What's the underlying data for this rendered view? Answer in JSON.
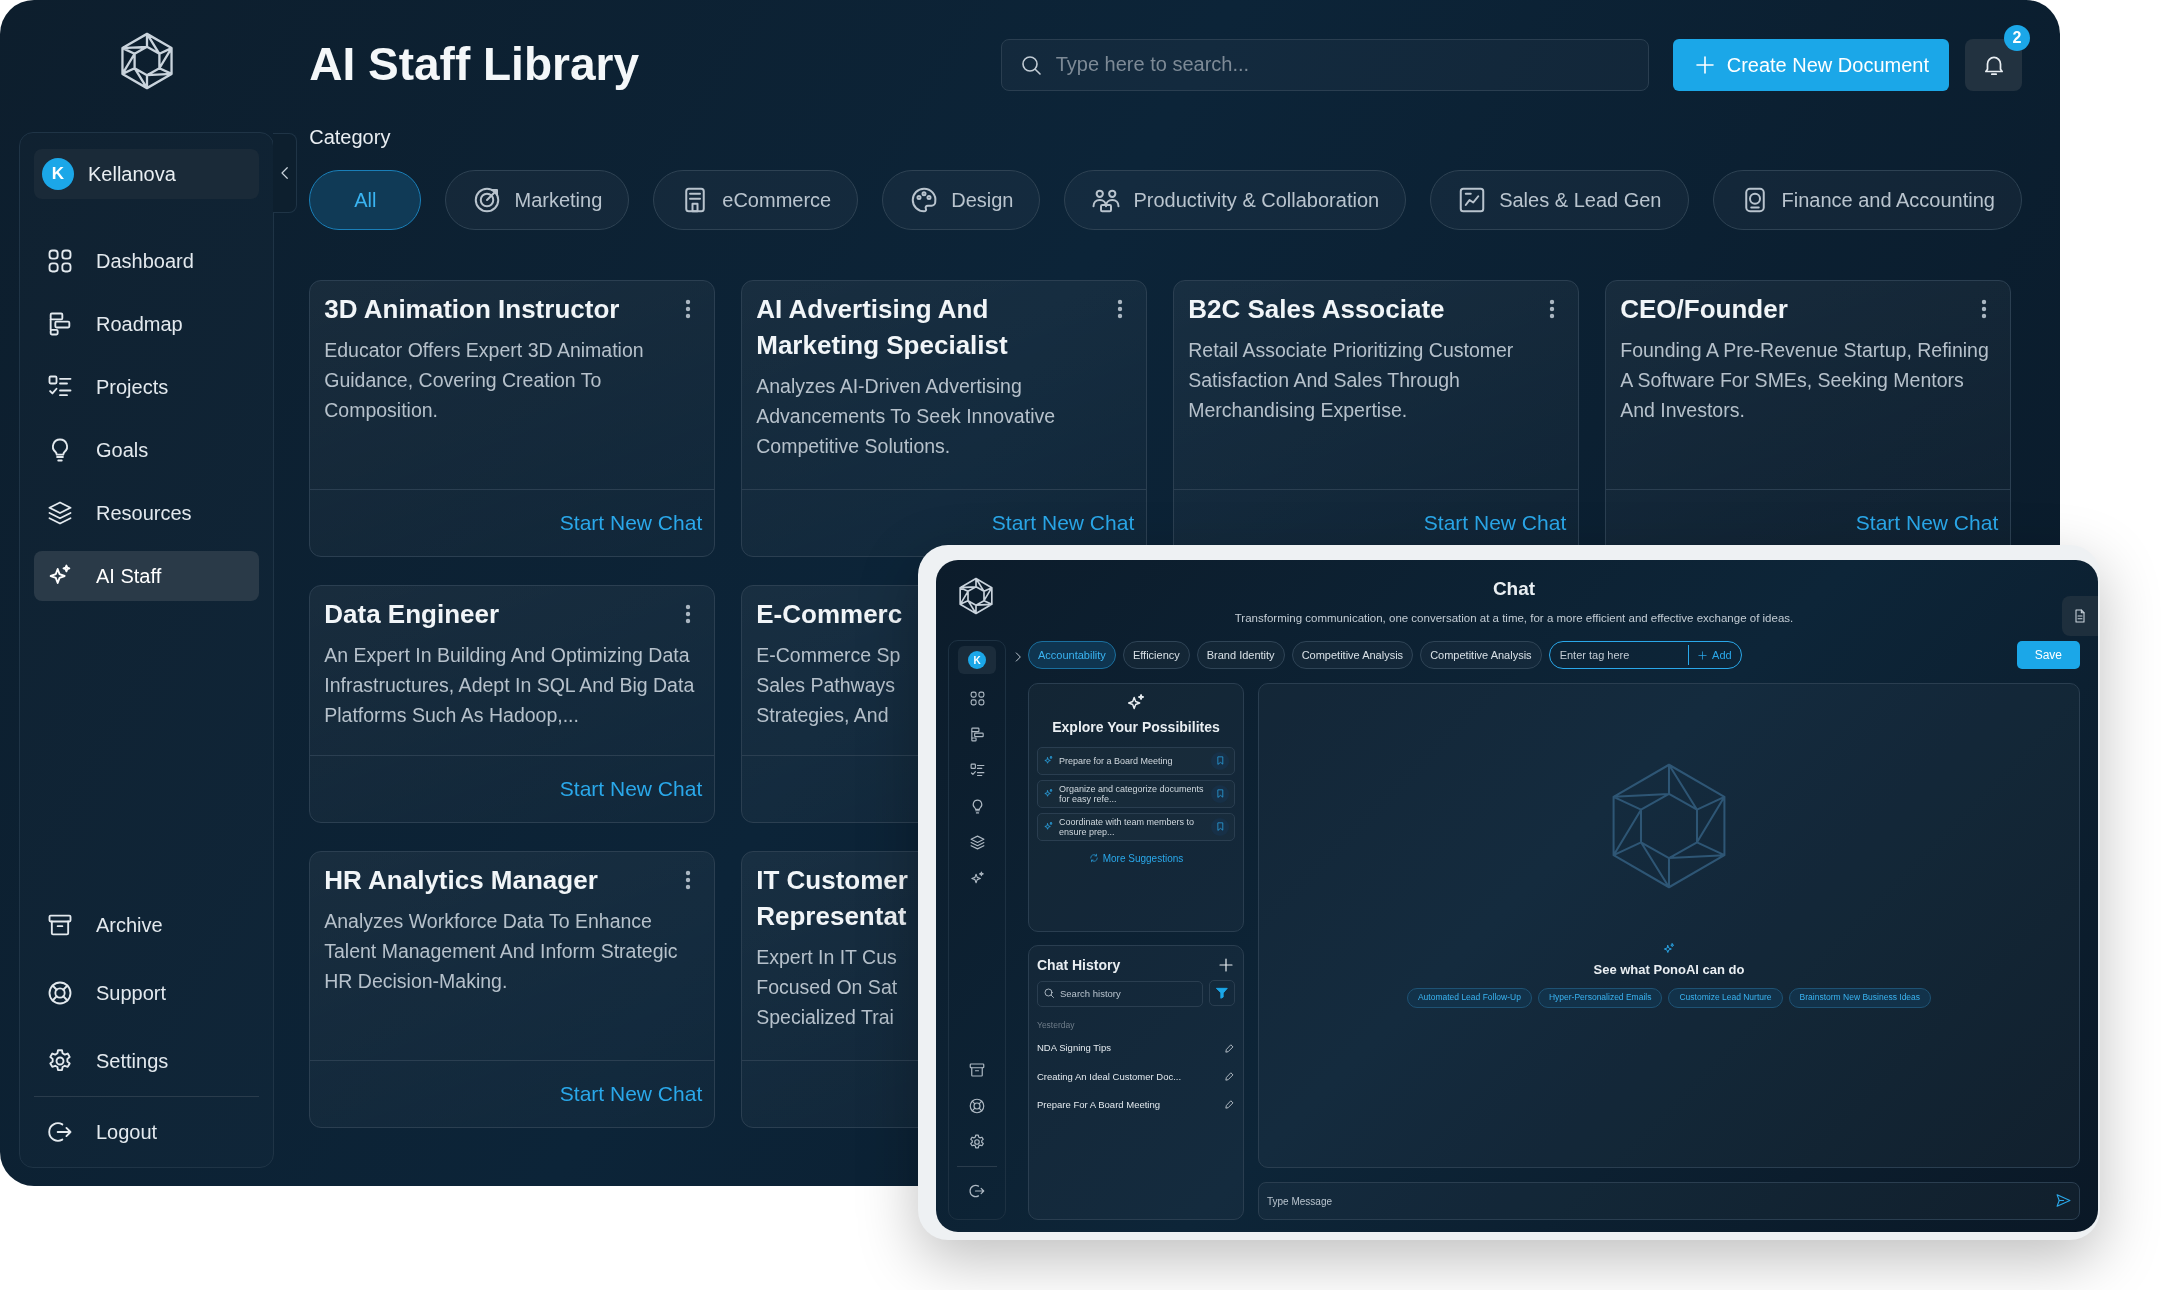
{
  "app": {
    "title": "AI Staff Library"
  },
  "search": {
    "placeholder": "Type here to search..."
  },
  "create_button": "Create New Document",
  "notifications": {
    "count": "2"
  },
  "sidebar": {
    "user": {
      "initial": "K",
      "name": "Kellanova"
    },
    "items": [
      {
        "label": "Dashboard",
        "selected": false
      },
      {
        "label": "Roadmap",
        "selected": false
      },
      {
        "label": "Projects",
        "selected": false
      },
      {
        "label": "Goals",
        "selected": false
      },
      {
        "label": "Resources",
        "selected": false
      },
      {
        "label": "AI Staff",
        "selected": true
      }
    ],
    "bottom_items": [
      "Archive",
      "Support",
      "Settings"
    ],
    "logout": "Logout"
  },
  "category": {
    "label": "Category",
    "chips": [
      {
        "label": "All",
        "selected": true
      },
      {
        "label": "Marketing",
        "selected": false
      },
      {
        "label": "eCommerce",
        "selected": false
      },
      {
        "label": "Design",
        "selected": false
      },
      {
        "label": "Productivity & Collaboration",
        "selected": false
      },
      {
        "label": "Sales & Lead Gen",
        "selected": false
      },
      {
        "label": "Finance and Accounting",
        "selected": false
      }
    ]
  },
  "card_rows": [
    [
      {
        "kind": "full",
        "title": "3D Animation Instructor",
        "description": "Educator Offers Expert 3D Animation Guidance, Covering Creation To Composition.",
        "action": "Start New Chat"
      },
      {
        "kind": "full",
        "title": "AI Advertising And Marketing Specialist",
        "description": "Analyzes AI-Driven Advertising Advancements To Seek Innovative Competitive Solutions.",
        "action": "Start New Chat"
      },
      {
        "kind": "full",
        "title": "B2C Sales Associate",
        "description": "Retail Associate Prioritizing Customer Satisfaction And Sales Through Merchandising Expertise.",
        "action": "Start New Chat"
      },
      {
        "kind": "full",
        "title": "CEO/Founder",
        "description": "Founding A Pre-Revenue Startup, Refining A Software For SMEs, Seeking Mentors And Investors.",
        "action": "Start New Chat"
      }
    ],
    [
      {
        "kind": "full",
        "title": "Data Engineer",
        "description": "An Expert In Building And Optimizing Data Infrastructures, Adept In SQL And Big Data Platforms Such As Hadoop,...",
        "action": "Start New Chat"
      },
      {
        "kind": "partial",
        "title_lines": [
          "E-Commerc"
        ],
        "description_lines": [
          "E-Commerce Sp",
          "Sales Pathways",
          "Strategies, And"
        ]
      }
    ],
    [
      {
        "kind": "full",
        "title": "HR Analytics Manager",
        "description": "Analyzes Workforce Data To Enhance Talent Management And Inform Strategic HR Decision-Making.",
        "action": "Start New Chat"
      },
      {
        "kind": "partial",
        "title_lines": [
          "IT Customer",
          "Representat"
        ],
        "description_lines": [
          "Expert In IT Cus",
          "Focused On Sat",
          "Specialized Trai"
        ]
      }
    ]
  ],
  "chat": {
    "title": "Chat",
    "subtitle": "Transforming communication, one conversation at a time, for a more efficient and effective exchange of ideas.",
    "user_initial": "K",
    "tags": [
      {
        "label": "Accountability",
        "selected": true
      },
      {
        "label": "Efficiency",
        "selected": false
      },
      {
        "label": "Brand Identity",
        "selected": false
      },
      {
        "label": "Competitive Analysis",
        "selected": false
      },
      {
        "label": "Competitive Analysis",
        "selected": false
      }
    ],
    "tag_input": {
      "placeholder": "Enter tag here"
    },
    "add_button": "Add",
    "save_button": "Save",
    "explore": {
      "title": "Explore Your Possibilites",
      "suggestions": [
        "Prepare for a Board Meeting",
        "Organize and categorize documents for easy refe...",
        "Coordinate with team members to ensure prep..."
      ],
      "more": "More Suggestions"
    },
    "history": {
      "title": "Chat History",
      "search_placeholder": "Search history",
      "group": "Yesterday",
      "items": [
        "NDA Signing Tips",
        "Creating An Ideal Customer Doc...",
        "Prepare For A Board Meeting"
      ]
    },
    "prompt": {
      "title": "See what PonoAI can do",
      "chips": [
        "Automated Lead Follow-Up",
        "Hyper-Personalized Emails",
        "Customize Lead Nurture",
        "Brainstorm New Business Ideas"
      ]
    },
    "message": {
      "placeholder": "Type Message"
    }
  }
}
